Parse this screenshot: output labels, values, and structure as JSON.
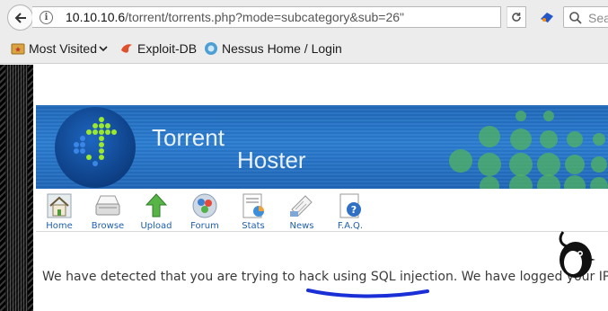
{
  "browser": {
    "url_host": "10.10.10.6",
    "url_path": "/torrent/torrents.php?mode=subcategory&sub=26\"",
    "search_placeholder": "Sea"
  },
  "bookmarks": [
    {
      "label": "Most Visited",
      "icon": "folder-star-icon"
    },
    {
      "label": "Exploit-DB",
      "icon": "exploitdb-icon"
    },
    {
      "label": "Nessus Home / Login",
      "icon": "nessus-icon"
    }
  ],
  "site": {
    "title_line1": "Torrent",
    "title_line2": "Hoster",
    "nav": [
      {
        "label": "Home",
        "icon": "home-icon"
      },
      {
        "label": "Browse",
        "icon": "browse-icon"
      },
      {
        "label": "Upload",
        "icon": "upload-icon"
      },
      {
        "label": "Forum",
        "icon": "forum-icon"
      },
      {
        "label": "Stats",
        "icon": "stats-icon"
      },
      {
        "label": "News",
        "icon": "news-icon"
      },
      {
        "label": "F.A.Q.",
        "icon": "faq-icon"
      }
    ],
    "notice": "We have detected that you are trying to hack using SQL injection. We have logged your IP."
  },
  "colors": {
    "banner": "#2a7cd0",
    "link": "#1f5fae",
    "annotation": "#1a2fd6"
  }
}
